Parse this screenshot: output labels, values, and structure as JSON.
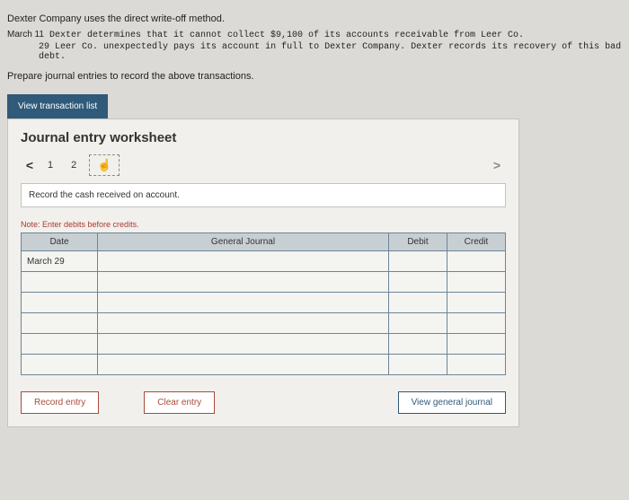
{
  "intro": {
    "line1": "Dexter Company uses the direct write-off method.",
    "line2_date": "March 11",
    "line2_text": "Dexter determines that it cannot collect $9,100 of its accounts receivable from Leer Co.",
    "line3_date": "29",
    "line3_text": "Leer Co. unexpectedly pays its account in full to Dexter Company. Dexter records its recovery of this bad debt.",
    "prepare": "Prepare journal entries to record the above transactions."
  },
  "buttons": {
    "view_trans": "View transaction list",
    "record": "Record entry",
    "clear": "Clear entry",
    "view_gj": "View general journal"
  },
  "worksheet": {
    "title": "Journal entry worksheet",
    "tabs": {
      "t1": "1",
      "t2": "2"
    },
    "chev_left": "<",
    "chev_right": ">",
    "hand": "☝",
    "instruction": "Record the cash received on account.",
    "note": "Note: Enter debits before credits.",
    "headers": {
      "date": "Date",
      "gj": "General Journal",
      "debit": "Debit",
      "credit": "Credit"
    },
    "rows": {
      "r0": {
        "date": "March 29"
      }
    }
  }
}
